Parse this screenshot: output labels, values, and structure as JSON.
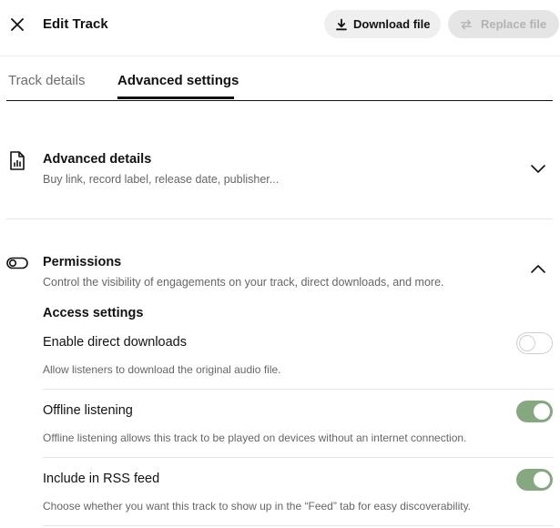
{
  "header": {
    "title": "Edit Track",
    "download_label": "Download file",
    "replace_label": "Replace file"
  },
  "tabs": [
    {
      "label": "Track details",
      "active": false
    },
    {
      "label": "Advanced settings",
      "active": true
    }
  ],
  "advanced_details": {
    "title": "Advanced details",
    "description": "Buy link, record label, release date, publisher...",
    "expanded": false
  },
  "permissions": {
    "title": "Permissions",
    "description": "Control the visibility of engagements on your track, direct downloads, and more.",
    "expanded": true,
    "access_title": "Access settings",
    "settings": [
      {
        "label": "Enable direct downloads",
        "description": "Allow listeners to download the original audio file.",
        "enabled": false
      },
      {
        "label": "Offline listening",
        "description": "Offline listening allows this track to be played on devices without an internet connection.",
        "enabled": true
      },
      {
        "label": "Include in RSS feed",
        "description": "Choose whether you want this track to show up in the “Feed” tab for easy discoverability.",
        "enabled": true
      }
    ]
  },
  "colors": {
    "toggle_on": "#85a87f",
    "toggle_off_border": "#cfcfcf",
    "text_primary": "#121212",
    "text_secondary": "#666666"
  },
  "icons": {
    "close": "close-icon",
    "download": "download-icon",
    "replace": "replace-icon",
    "advanced_details": "file-chart-icon",
    "permissions": "toggle-icon",
    "chevron_down": "chevron-down-icon",
    "chevron_up": "chevron-up-icon"
  }
}
